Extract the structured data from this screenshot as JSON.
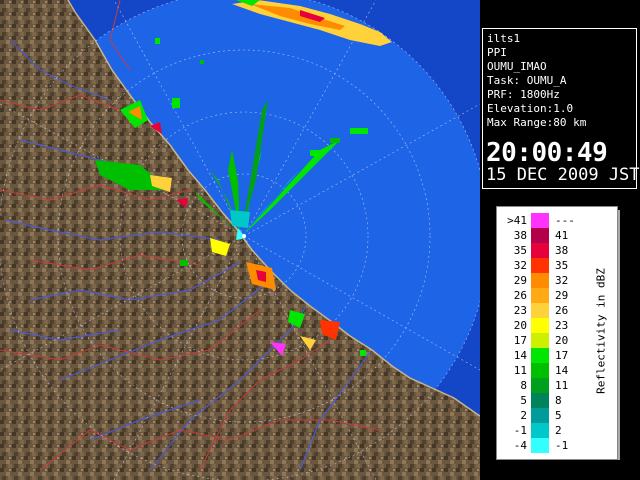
{
  "info": {
    "site": "ilts1",
    "product": "PPI",
    "station": "OUMU_IMAO",
    "task": "Task: OUMU_A",
    "prf": "PRF: 1800Hz",
    "elevation": "Elevation:1.0",
    "max_range": "Max Range:80 km",
    "time": "20:00:49",
    "date": "15 DEC 2009 JST"
  },
  "legend": {
    "title": "Reflectivity in dBZ",
    "rows": [
      {
        "low": ">41",
        "high": "---",
        "color": "#ff33ff"
      },
      {
        "low": "38",
        "high": "41",
        "color": "#b4004b"
      },
      {
        "low": "35",
        "high": "38",
        "color": "#e6003c"
      },
      {
        "low": "32",
        "high": "35",
        "color": "#ff3200"
      },
      {
        "low": "29",
        "high": "32",
        "color": "#ff8c00"
      },
      {
        "low": "26",
        "high": "29",
        "color": "#ffaa14"
      },
      {
        "low": "23",
        "high": "26",
        "color": "#ffd23c"
      },
      {
        "low": "20",
        "high": "23",
        "color": "#ffff00"
      },
      {
        "low": "17",
        "high": "20",
        "color": "#cdf000"
      },
      {
        "low": "14",
        "high": "17",
        "color": "#00e600"
      },
      {
        "low": "11",
        "high": "14",
        "color": "#00be00"
      },
      {
        "low": "8",
        "high": "11",
        "color": "#00a01e"
      },
      {
        "low": "5",
        "high": "8",
        "color": "#00825a"
      },
      {
        "low": "2",
        "high": "5",
        "color": "#009b9b"
      },
      {
        "low": "-1",
        "high": "2",
        "color": "#00c8c8"
      },
      {
        "low": "-4",
        "high": "-1",
        "color": "#32ffff"
      }
    ]
  },
  "colors": {
    "sea": "#1e64e6",
    "sea_outside_range": "#1446c8",
    "land": "#7a6448",
    "land_dark": "#4f3f2c",
    "land_light": "#a08866",
    "river": "#4a5bd0",
    "border": "#c83c3c",
    "range_ring": "#d0d8ff"
  }
}
